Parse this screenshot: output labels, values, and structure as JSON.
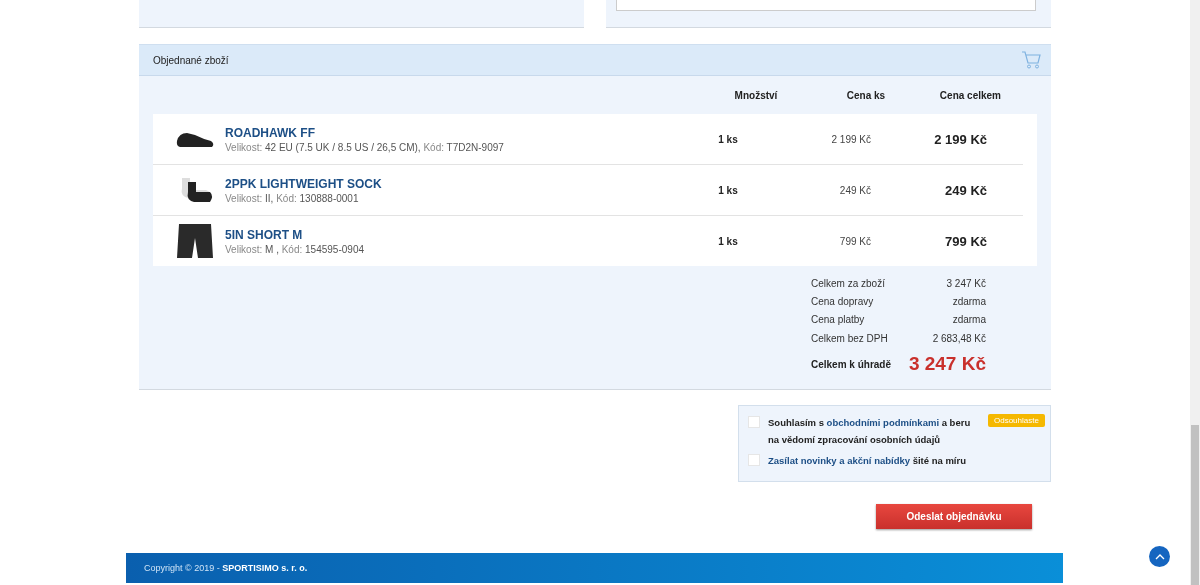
{
  "cart": {
    "title": "Objednané zboží",
    "columns": [
      "Množství",
      "Cena ks",
      "Cena celkem"
    ],
    "items": [
      {
        "kind": "shoe",
        "name": "ROADHAWK FF",
        "details": [
          {
            "label": "Velikost:",
            "value": "42 EU (7.5 UK / 8.5 US / 26,5 CM),"
          },
          {
            "label": "Kód:",
            "value": "T7D2N-9097"
          }
        ],
        "quantity": "1 ks",
        "unit_price": "2 199 Kč",
        "total": "2 199 Kč"
      },
      {
        "kind": "sock",
        "name": "2PPK LIGHTWEIGHT SOCK",
        "details": [
          {
            "label": "Velikost:",
            "value": "II,"
          },
          {
            "label": "Kód:",
            "value": "130888-0001"
          }
        ],
        "quantity": "1 ks",
        "unit_price": "249 Kč",
        "total": "249 Kč"
      },
      {
        "kind": "shorts",
        "name": "5IN SHORT M",
        "details": [
          {
            "label": "Velikost:",
            "value": "M ,"
          },
          {
            "label": "Kód:",
            "value": "154595-0904"
          }
        ],
        "quantity": "1 ks",
        "unit_price": "799 Kč",
        "total": "799 Kč"
      }
    ],
    "summary": [
      {
        "label": "Celkem za zboží",
        "value": "3 247 Kč"
      },
      {
        "label": "Cena dopravy",
        "value": "zdarma"
      },
      {
        "label": "Cena platby",
        "value": "zdarma"
      },
      {
        "label": "Celkem bez DPH",
        "value": "2 683,48 Kč"
      }
    ],
    "grand_total": {
      "label": "Celkem k úhradě",
      "value": "3 247 Kč"
    }
  },
  "consents": [
    {
      "checked": false,
      "before": "Souhlasím s ",
      "link": "obchodními podmínkami",
      "after": " a beru na vědomí zpracování osobních údajů",
      "warning": "Odsouhlaste"
    },
    {
      "checked": false,
      "link": "Zasílat novinky a akční nabídky",
      "after": " šité na míru"
    }
  ],
  "submit": "Odeslat objednávku",
  "footer": {
    "text": "Copyright © 2019 - ",
    "company": "SPORTISIMO s. r. o."
  }
}
